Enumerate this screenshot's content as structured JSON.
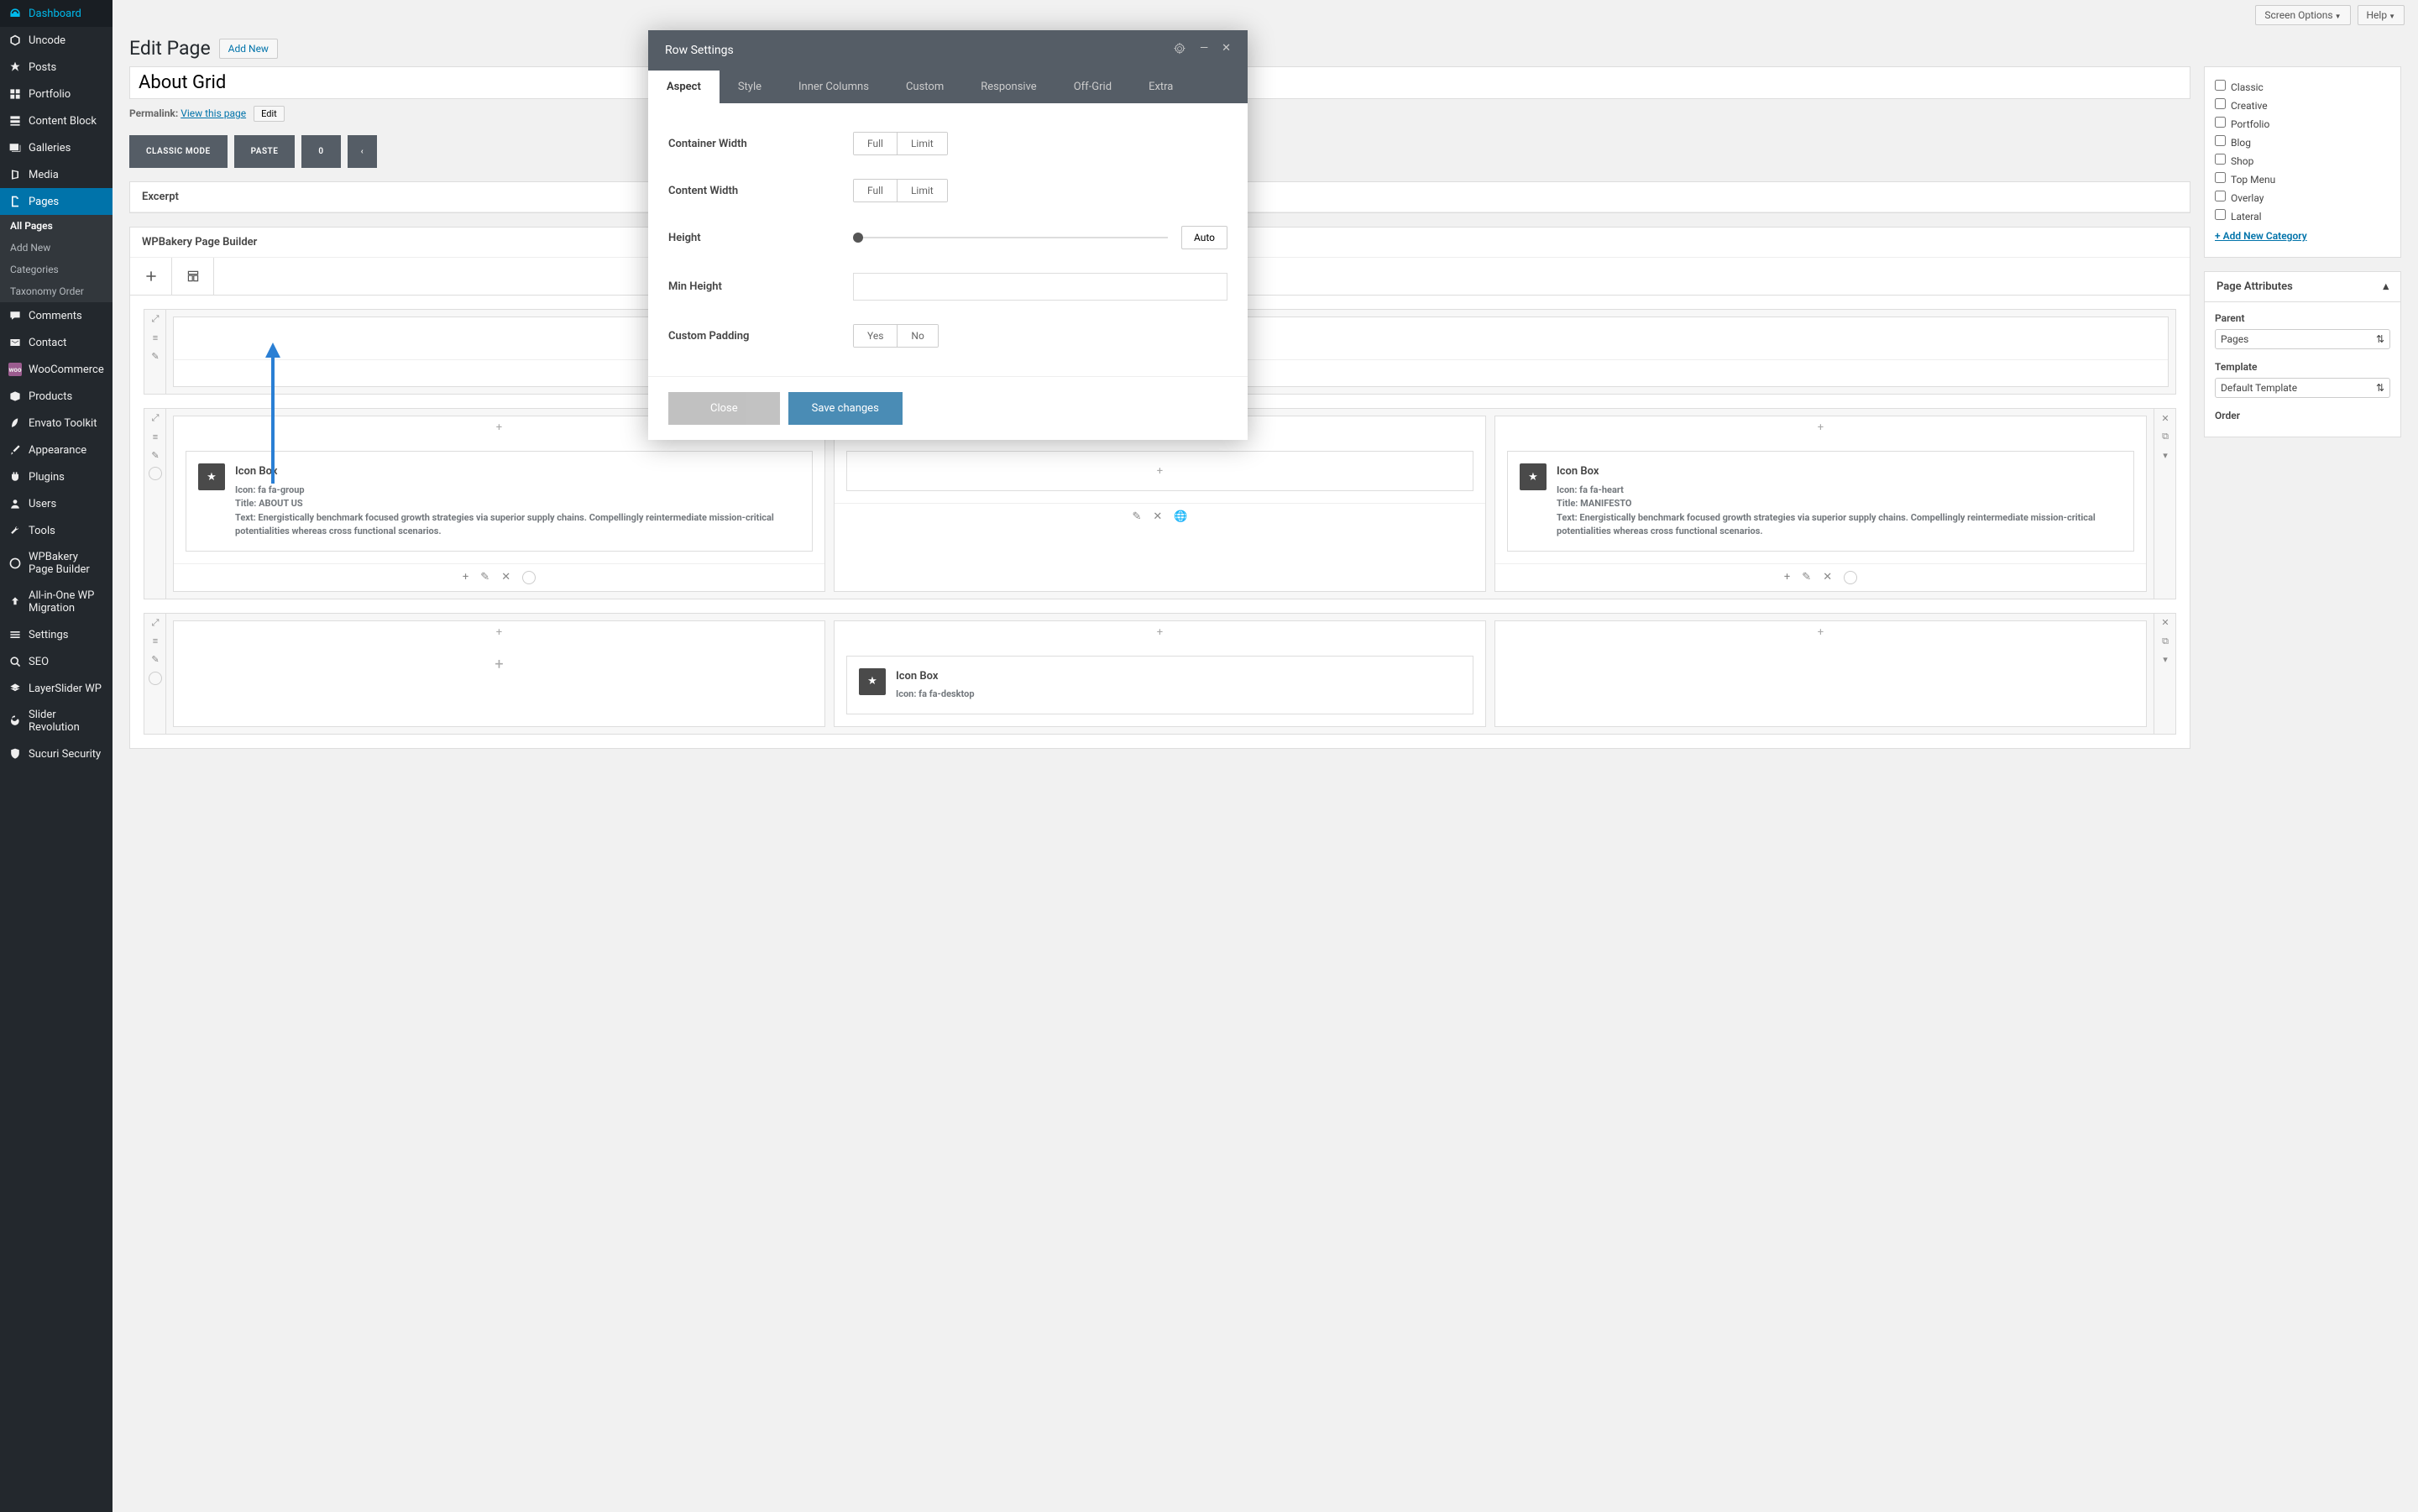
{
  "topbar": {
    "screen_options": "Screen Options",
    "help": "Help"
  },
  "sidebar": {
    "items": [
      {
        "icon": "dashboard",
        "label": "Dashboard"
      },
      {
        "icon": "uncode",
        "label": "Uncode"
      },
      {
        "icon": "pin",
        "label": "Posts"
      },
      {
        "icon": "grid",
        "label": "Portfolio"
      },
      {
        "icon": "blocks",
        "label": "Content Block"
      },
      {
        "icon": "gallery",
        "label": "Galleries"
      },
      {
        "icon": "media",
        "label": "Media"
      },
      {
        "icon": "page",
        "label": "Pages"
      },
      {
        "icon": "comment",
        "label": "Comments"
      },
      {
        "icon": "contact",
        "label": "Contact"
      },
      {
        "icon": "woo",
        "label": "WooCommerce"
      },
      {
        "icon": "products",
        "label": "Products"
      },
      {
        "icon": "envato",
        "label": "Envato Toolkit"
      },
      {
        "icon": "appearance",
        "label": "Appearance"
      },
      {
        "icon": "plugins",
        "label": "Plugins"
      },
      {
        "icon": "users",
        "label": "Users"
      },
      {
        "icon": "tools",
        "label": "Tools"
      },
      {
        "icon": "wpbakery",
        "label": "WPBakery Page Builder"
      },
      {
        "icon": "migration",
        "label": "All-in-One WP Migration"
      },
      {
        "icon": "settings",
        "label": "Settings"
      },
      {
        "icon": "seo",
        "label": "SEO"
      },
      {
        "icon": "layerslider",
        "label": "LayerSlider WP"
      },
      {
        "icon": "slider",
        "label": "Slider Revolution"
      },
      {
        "icon": "sucuri",
        "label": "Sucuri Security"
      }
    ],
    "sub": [
      {
        "label": "All Pages",
        "active": true
      },
      {
        "label": "Add New"
      },
      {
        "label": "Categories"
      },
      {
        "label": "Taxonomy Order"
      }
    ]
  },
  "header": {
    "title": "Edit Page",
    "add_new": "Add New"
  },
  "title_input": "About Grid",
  "permalink": {
    "label": "Permalink:",
    "url": "View this page",
    "edit": "Edit"
  },
  "modes": {
    "classic": "CLASSIC MODE",
    "paste": "PASTE",
    "zero": "0"
  },
  "panels": {
    "excerpt": "Excerpt",
    "builder": "WPBakery Page Builder"
  },
  "iconbox1": {
    "title": "Icon Box",
    "line1": "Icon: fa fa-group",
    "line2": "Title: ABOUT US",
    "line3": "Text: Energistically benchmark focused growth strategies via superior supply chains. Compellingly reintermediate mission-critical potentialities whereas cross functional scenarios."
  },
  "iconbox2": {
    "title": "Icon Box",
    "line1": "Icon: fa fa-heart",
    "line2": "Title: MANIFESTO",
    "line3": "Text: Energistically benchmark focused growth strategies via superior supply chains. Compellingly reintermediate mission-critical potentialities whereas cross functional scenarios."
  },
  "iconbox3": {
    "title": "Icon Box",
    "line1": "Icon: fa fa-desktop"
  },
  "categories": {
    "items": [
      "Classic",
      "Creative",
      "Portfolio",
      "Blog",
      "Shop",
      "Top Menu",
      "Overlay",
      "Lateral"
    ],
    "add": "+ Add New Category"
  },
  "page_attr": {
    "title": "Page Attributes",
    "parent_label": "Parent",
    "parent_value": "Pages",
    "template_label": "Template",
    "template_value": "Default Template",
    "order_label": "Order"
  },
  "modal": {
    "title": "Row Settings",
    "tabs": [
      "Aspect",
      "Style",
      "Inner Columns",
      "Custom",
      "Responsive",
      "Off-Grid",
      "Extra"
    ],
    "settings": {
      "container_width": "Container Width",
      "content_width": "Content Width",
      "height": "Height",
      "min_height": "Min Height",
      "custom_padding": "Custom Padding",
      "full": "Full",
      "limit": "Limit",
      "auto": "Auto",
      "yes": "Yes",
      "no": "No"
    },
    "close": "Close",
    "save": "Save changes"
  }
}
